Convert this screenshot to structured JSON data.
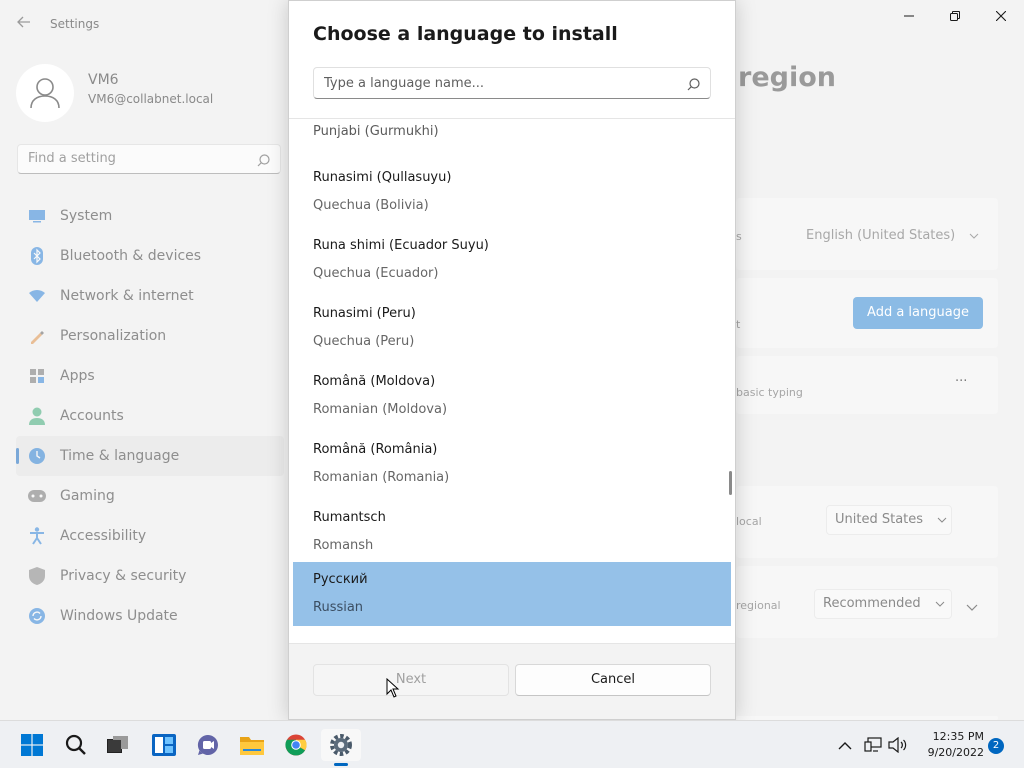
{
  "settings": {
    "title": "Settings",
    "user": {
      "name": "VM6",
      "email": "VM6@collabnet.local"
    },
    "search_placeholder": "Find a setting",
    "nav": [
      {
        "label": "System",
        "icon": "system-icon"
      },
      {
        "label": "Bluetooth & devices",
        "icon": "bluetooth-icon"
      },
      {
        "label": "Network & internet",
        "icon": "network-icon"
      },
      {
        "label": "Personalization",
        "icon": "brush-icon"
      },
      {
        "label": "Apps",
        "icon": "apps-icon"
      },
      {
        "label": "Accounts",
        "icon": "accounts-icon"
      },
      {
        "label": "Time & language",
        "icon": "globe-clock-icon",
        "active": true
      },
      {
        "label": "Gaming",
        "icon": "gamepad-icon"
      },
      {
        "label": "Accessibility",
        "icon": "accessibility-icon"
      },
      {
        "label": "Privacy & security",
        "icon": "shield-icon"
      },
      {
        "label": "Windows Update",
        "icon": "update-icon"
      }
    ],
    "page_heading": "region",
    "display_language_label": "s",
    "display_language_value": "English (United States)",
    "preferred_languages_label": "t",
    "add_language_label": "Add a language",
    "language_item_note": "basic typing",
    "more_label": "···",
    "country_label": "local",
    "country_value": "United States",
    "regional_format_label": "regional",
    "regional_format_value": "Recommended"
  },
  "dialog": {
    "title": "Choose a language to install",
    "search_placeholder": "Type a language name...",
    "partial_item": "Punjabi (Gurmukhi)",
    "languages": [
      {
        "native": "Runasimi (Qullasuyu)",
        "english": "Quechua (Bolivia)"
      },
      {
        "native": "Runa shimi (Ecuador Suyu)",
        "english": "Quechua (Ecuador)"
      },
      {
        "native": "Runasimi (Peru)",
        "english": "Quechua (Peru)"
      },
      {
        "native": "Română (Moldova)",
        "english": "Romanian (Moldova)"
      },
      {
        "native": "Română (România)",
        "english": "Romanian (Romania)"
      },
      {
        "native": "Rumantsch",
        "english": "Romansh"
      },
      {
        "native": "Русский",
        "english": "Russian",
        "selected": true
      }
    ],
    "next_label": "Next",
    "cancel_label": "Cancel"
  },
  "taskbar": {
    "apps": [
      "start-icon",
      "search-icon",
      "task-view-icon",
      "widgets-icon",
      "teams-chat-icon",
      "file-explorer-icon",
      "chrome-icon",
      "settings-icon"
    ],
    "time": "12:35 PM",
    "date": "9/20/2022",
    "notification_count": "2"
  },
  "colors": {
    "accent": "#0067c0",
    "selection": "#95c1e8",
    "disabled_button": "#8bbbe5"
  }
}
